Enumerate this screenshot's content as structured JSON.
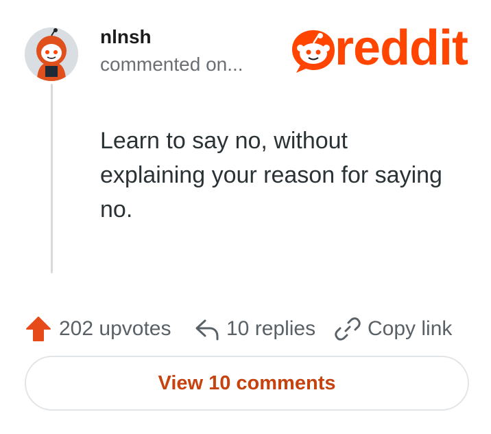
{
  "comment": {
    "username": "nlnsh",
    "meta": "commented on...",
    "body": "Learn to say no, without explaining your reason for saying no."
  },
  "brand": {
    "wordmark": "reddit",
    "color": "#ff4500"
  },
  "actions": {
    "upvotes": "202 upvotes",
    "replies": "10 replies",
    "copy_link": "Copy link"
  },
  "view_comments": "View 10 comments",
  "icons": {
    "avatar": "snoo-avatar",
    "upvote": "upvote-arrow-icon",
    "reply": "reply-arrow-icon",
    "link": "chain-link-icon"
  }
}
